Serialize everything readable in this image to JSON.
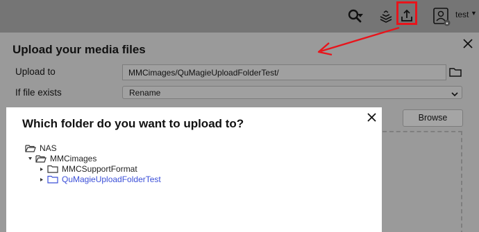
{
  "topbar": {
    "search_icon": "search-icon",
    "stack_icon": "task-stack-icon",
    "upload_icon": "upload-icon",
    "user_icon": "user-avatar-icon",
    "user_name": "test",
    "highlight_color": "#e8141b"
  },
  "upload_panel": {
    "title": "Upload your media files",
    "upload_to_label": "Upload to",
    "upload_to_value": "MMCimages/QuMagieUploadFolderTest/",
    "if_exists_label": "If file exists",
    "if_exists_value": "Rename",
    "browse_label": "Browse"
  },
  "folder_dialog": {
    "title": "Which folder do you want to upload to?",
    "tree": [
      {
        "label": "NAS",
        "state": "open"
      },
      {
        "label": "MMCimages",
        "state": "open"
      },
      {
        "label": "MMCSupportFormat",
        "state": "closed"
      },
      {
        "label": "QuMagieUploadFolderTest",
        "state": "closed",
        "selected": true
      }
    ],
    "selected_color": "#3b4fd8"
  }
}
